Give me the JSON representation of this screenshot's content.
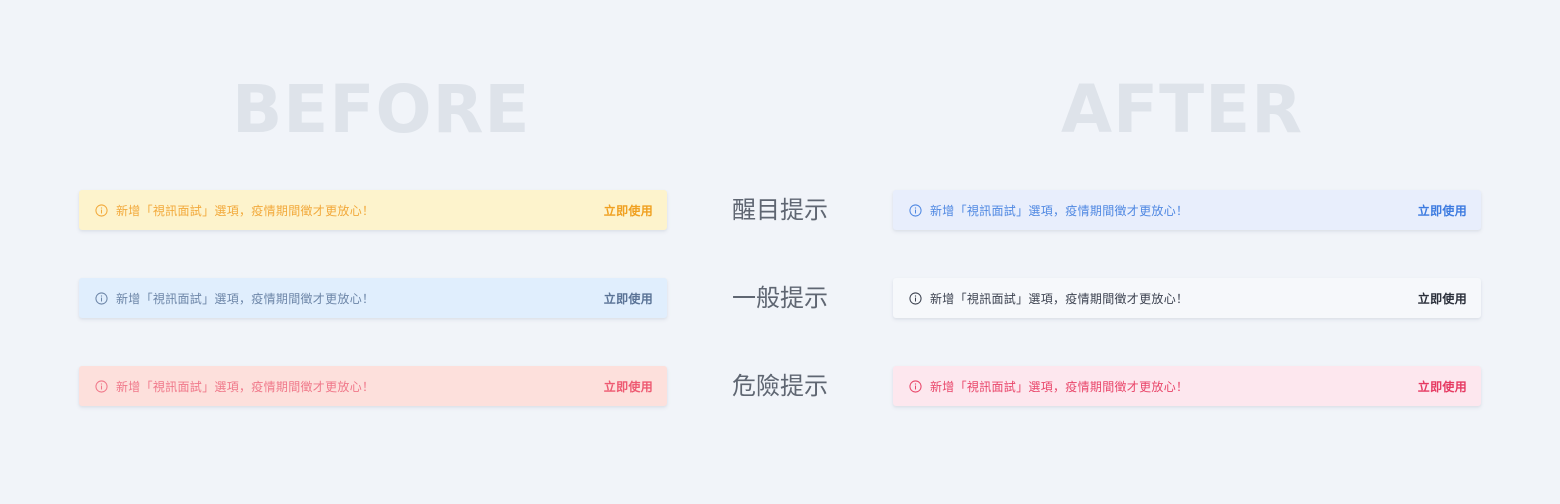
{
  "headings": {
    "before": "BEFORE",
    "after": "AFTER"
  },
  "labels": [
    "醒目提示",
    "一般提示",
    "危險提示"
  ],
  "alert": {
    "message": "新增「視訊面試」選項，疫情期間徵才更放心！",
    "action": "立即使用",
    "icon": "info-circle-icon"
  },
  "before_alerts": [
    {
      "variant": "yellow",
      "bg": "#fdf3cc",
      "text_color": "#f2a93b"
    },
    {
      "variant": "blue",
      "bg": "#e0eefd",
      "text_color": "#6d86a8"
    },
    {
      "variant": "red",
      "bg": "#fde0dc",
      "text_color": "#f0788a"
    }
  ],
  "after_alerts": [
    {
      "variant": "blue",
      "bg": "#e8eefc",
      "text_color": "#4f88e2"
    },
    {
      "variant": "neutral",
      "bg": "#f6f8fb",
      "text_color": "#3c4250"
    },
    {
      "variant": "pink",
      "bg": "#fde7ee",
      "text_color": "#e9466a"
    }
  ],
  "colors": {
    "page_bg": "#f1f4f9",
    "heading": "#dee3ea",
    "label": "#5f6672"
  }
}
